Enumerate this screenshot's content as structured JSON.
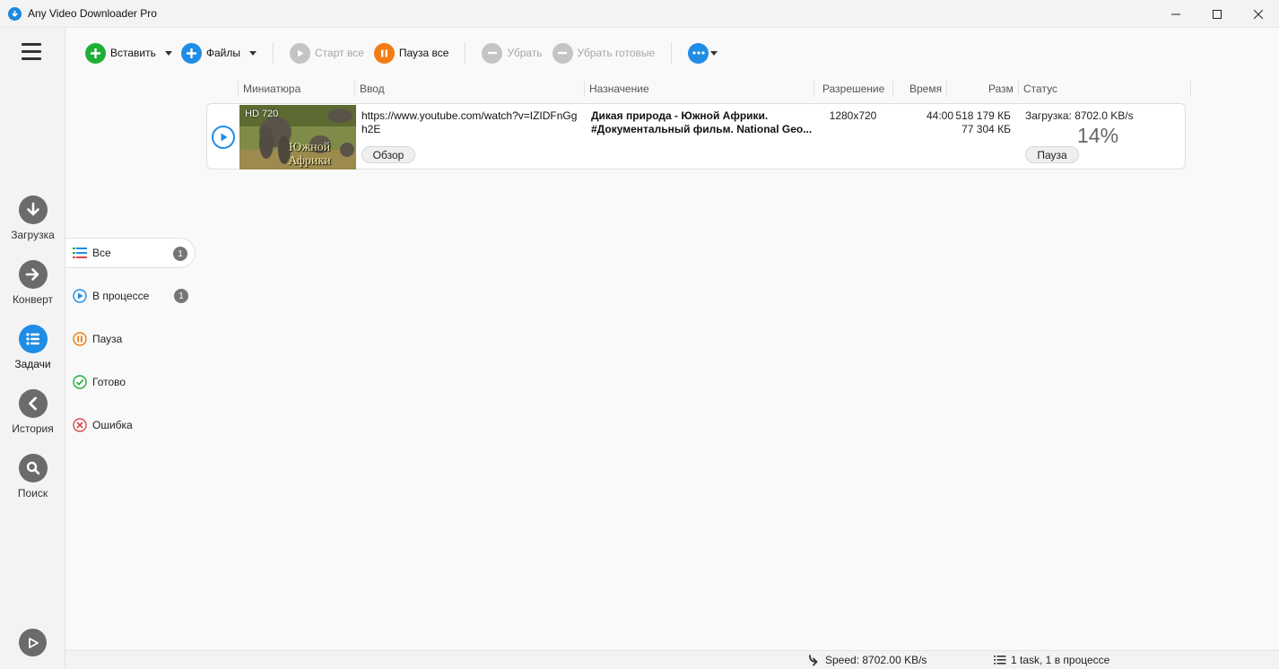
{
  "window": {
    "title": "Any Video Downloader Pro"
  },
  "sidebar": {
    "items": [
      {
        "label": "Загрузка",
        "icon": "download-arrow-icon"
      },
      {
        "label": "Конверт",
        "icon": "convert-arrow-icon"
      },
      {
        "label": "Задачи",
        "icon": "task-list-icon"
      },
      {
        "label": "История",
        "icon": "history-back-icon"
      },
      {
        "label": "Поиск",
        "icon": "search-icon"
      }
    ],
    "active_index": 2
  },
  "toolbar": {
    "paste_label": "Вставить",
    "files_label": "Файлы",
    "start_all_label": "Старт все",
    "pause_all_label": "Пауза все",
    "remove_label": "Убрать",
    "remove_done_label": "Убрать готовые"
  },
  "filters": [
    {
      "label": "Все",
      "count": "1"
    },
    {
      "label": "В процессе",
      "count": "1"
    },
    {
      "label": "Пауза"
    },
    {
      "label": "Готово"
    },
    {
      "label": "Ошибка"
    }
  ],
  "table": {
    "headers": [
      "Миниатюра",
      "Ввод",
      "Назначение",
      "Разрешение",
      "Время",
      "Разм",
      "Статус"
    ],
    "rows": [
      {
        "thumb_badge": "HD 720",
        "thumb_caption": "Южной Африки",
        "url": "https://www.youtube.com/watch?v=IZIDFnGgh2E",
        "browse_label": "Обзор",
        "dest_line1": "Дикая природа - Южной Африки.",
        "dest_line2": "#Документальный фильм. National Geo...",
        "resolution": "1280x720",
        "duration": "44:00",
        "size_total": "518 179 КБ",
        "size_done": "77 304 КБ",
        "status": "Загрузка: 8702.0 KB/s",
        "percent": "14%",
        "progress": 0.14,
        "pause_label": "Пауза"
      }
    ]
  },
  "statusbar": {
    "speed": "Speed: 8702.00 KB/s",
    "tasks": "1 task, 1 в процессе"
  },
  "colors": {
    "accent": "#1f8ce6",
    "green": "#1fae34",
    "orange": "#f07c13",
    "error": "#e04848"
  }
}
